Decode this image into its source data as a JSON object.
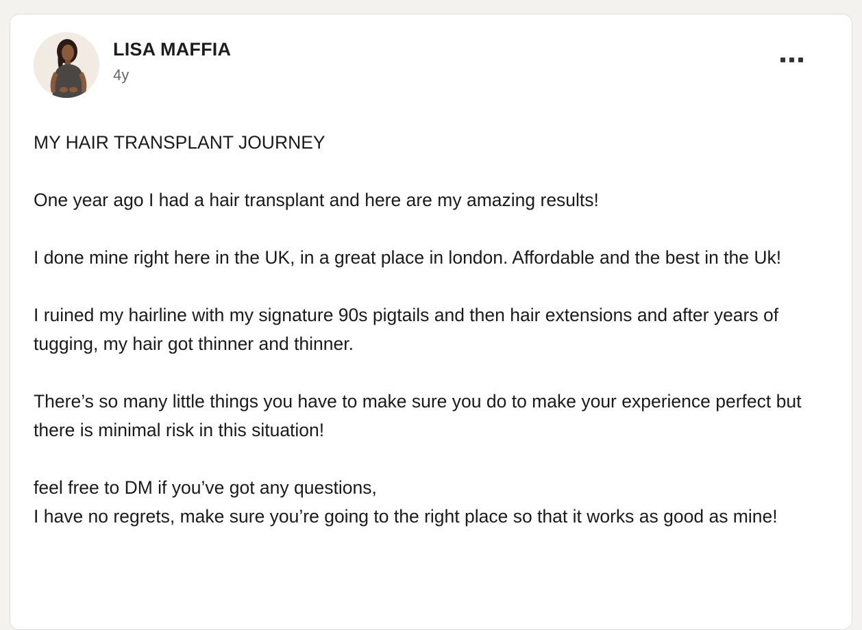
{
  "post": {
    "author": {
      "name": "LISA MAFFIA",
      "timestamp": "4y",
      "avatar_icon": "profile-photo"
    },
    "more_icon": "ellipsis-icon",
    "paragraphs": [
      "MY HAIR TRANSPLANT JOURNEY",
      "One year ago I had a hair transplant and here are my amazing results!",
      "I done mine right here in the UK, in a great place in london. Affordable and the best in the Uk!",
      "I ruined my hairline with my signature 90s pigtails and then hair extensions and after years of tugging, my hair got thinner and thinner.",
      "There’s so many little things you have to make sure you do to make your experience perfect but there is minimal risk in this situation!"
    ],
    "closing": {
      "line1": "feel free to DM if you’ve got any questions,",
      "line2": "I have no regrets, make sure you’re going to the right place so that it works as good as mine!"
    }
  },
  "colors": {
    "card_background": "#ffffff",
    "card_border": "#dcdcdc",
    "text_primary": "#1a1a1a",
    "text_secondary": "#666666"
  }
}
